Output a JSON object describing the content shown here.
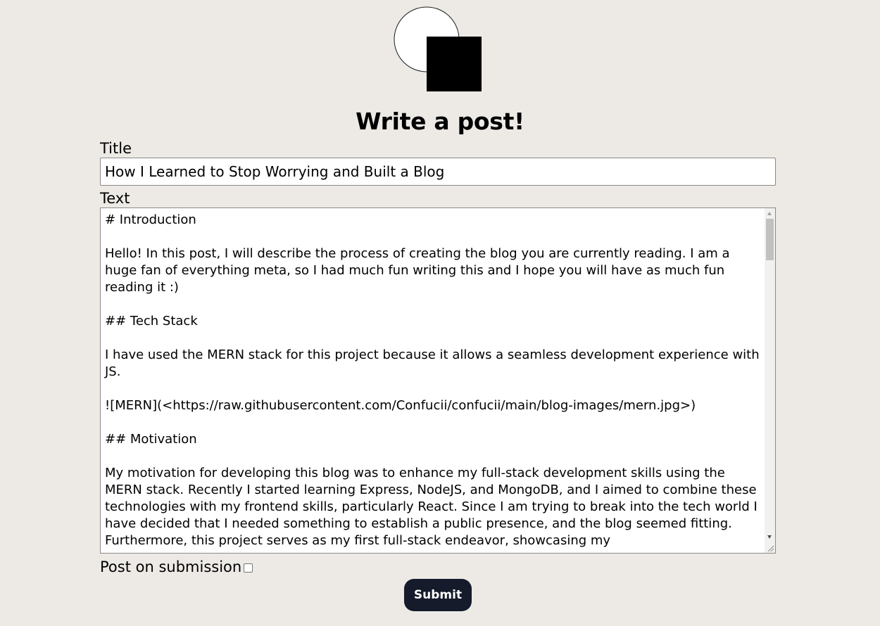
{
  "heading": "Write a post!",
  "title_field": {
    "label": "Title",
    "value": "How I Learned to Stop Worrying and Built a Blog"
  },
  "text_field": {
    "label": "Text",
    "value": "# Introduction\n\nHello! In this post, I will describe the process of creating the blog you are currently reading. I am a huge fan of everything meta, so I had much fun writing this and I hope you will have as much fun reading it :)\n\n## Tech Stack\n\nI have used the MERN stack for this project because it allows a seamless development experience with JS.\n\n![MERN](<https://raw.githubusercontent.com/Confucii/confucii/main/blog-images/mern.jpg>)\n\n## Motivation\n\nMy motivation for developing this blog was to enhance my full-stack development skills using the MERN stack. Recently I started learning Express, NodeJS, and MongoDB, and I aimed to combine these technologies with my frontend skills, particularly React. Since I am trying to break into the tech world I have decided that I needed something to establish a public presence, and the blog seemed fitting. Furthermore, this project serves as my first full-stack endeavor, showcasing my"
  },
  "post_on_submission": {
    "label": "Post on submission",
    "checked": false
  },
  "submit_label": "Submit"
}
